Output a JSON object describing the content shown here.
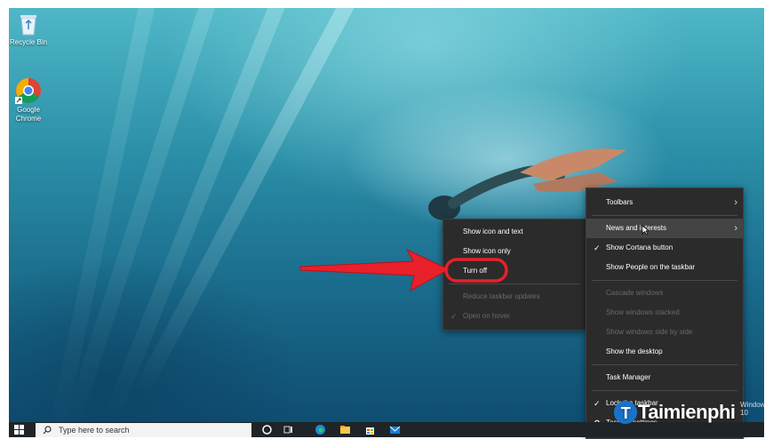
{
  "desktop_icons": [
    {
      "name": "recycle-bin",
      "label": "Recycle Bin"
    },
    {
      "name": "google-chrome",
      "label": "Google Chrome"
    }
  ],
  "news_submenu": {
    "items": [
      {
        "label": "Show icon and text",
        "checked": false,
        "disabled": false
      },
      {
        "label": "Show icon only",
        "checked": false,
        "disabled": false
      },
      {
        "label": "Turn off",
        "checked": false,
        "disabled": false,
        "highlighted": true
      },
      {
        "label": "Reduce taskbar updates",
        "checked": false,
        "disabled": true
      },
      {
        "label": "Open on hover",
        "checked": true,
        "disabled": true
      }
    ]
  },
  "taskbar_menu": {
    "items": [
      {
        "label": "Toolbars",
        "submenu": true
      },
      {
        "label": "News and interests",
        "submenu": true,
        "hover": true
      },
      {
        "label": "Show Cortana button",
        "checked": true
      },
      {
        "label": "Show People on the taskbar"
      },
      {
        "label": "Cascade windows",
        "disabled": true
      },
      {
        "label": "Show windows stacked",
        "disabled": true
      },
      {
        "label": "Show windows side by side",
        "disabled": true
      },
      {
        "label": "Show the desktop"
      },
      {
        "label": "Task Manager"
      },
      {
        "label": "Lock the taskbar",
        "checked": true
      },
      {
        "label": "Taskbar settings"
      }
    ]
  },
  "taskbar": {
    "search_placeholder": "Type here to search"
  },
  "activation_text": "Windows 10",
  "watermark": "Taimienphi",
  "colors": {
    "arrow": "#e8202a",
    "highlight_ring": "#e8202a",
    "menu_bg": "#2b2b2b"
  }
}
